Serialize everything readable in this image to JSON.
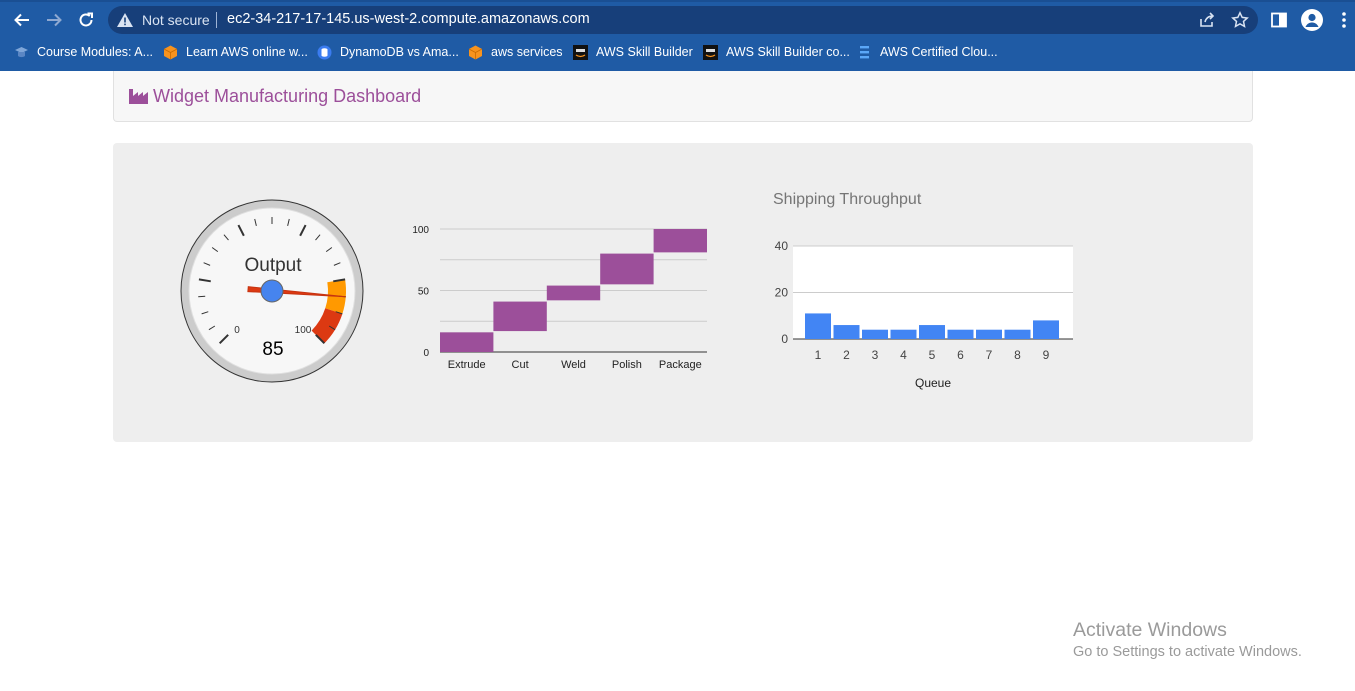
{
  "browser": {
    "security_label": "Not secure",
    "url": "ec2-34-217-17-145.us-west-2.compute.amazonaws.com",
    "bookmarks": [
      {
        "label": "Course Modules: A...",
        "icon": "graduation-icon"
      },
      {
        "label": "Learn AWS online w...",
        "icon": "aws-cube-icon"
      },
      {
        "label": "DynamoDB vs Ama...",
        "icon": "database-icon"
      },
      {
        "label": "aws services",
        "icon": "aws-cube-icon"
      },
      {
        "label": "AWS Skill Builder",
        "icon": "aws-logo-icon"
      },
      {
        "label": "AWS Skill Builder co...",
        "icon": "aws-logo-icon"
      },
      {
        "label": "AWS Certified Clou...",
        "icon": "document-icon"
      }
    ]
  },
  "page": {
    "title": "Widget Manufacturing Dashboard",
    "colors": {
      "accent": "#9c4f9a",
      "bar": "#4285f4",
      "waterfall": "#9c4f9a"
    }
  },
  "chart_data": [
    {
      "type": "gauge",
      "label": "Output",
      "value": 85,
      "min": 0,
      "max": 100,
      "tick_labels": [
        "0",
        "100"
      ],
      "bands": [
        {
          "from": 80,
          "to": 90,
          "color": "#ff9900"
        },
        {
          "from": 90,
          "to": 100,
          "color": "#dc3912"
        }
      ]
    },
    {
      "type": "waterfall",
      "categories": [
        "Extrude",
        "Cut",
        "Weld",
        "Polish",
        "Package"
      ],
      "ranges": [
        [
          0,
          16
        ],
        [
          17,
          41
        ],
        [
          42,
          54
        ],
        [
          55,
          80
        ],
        [
          81,
          100
        ]
      ],
      "yticks": [
        "0",
        "50",
        "100"
      ],
      "ylim": [
        0,
        100
      ]
    },
    {
      "type": "bar",
      "title": "Shipping Throughput",
      "xlabel": "Queue",
      "categories": [
        "1",
        "2",
        "3",
        "4",
        "5",
        "6",
        "7",
        "8",
        "9"
      ],
      "values": [
        11,
        6,
        4,
        4,
        6,
        4,
        4,
        4,
        8
      ],
      "yticks": [
        "0",
        "20",
        "40"
      ],
      "ylim": [
        0,
        40
      ]
    }
  ],
  "watermark": {
    "title": "Activate Windows",
    "subtitle": "Go to Settings to activate Windows."
  }
}
